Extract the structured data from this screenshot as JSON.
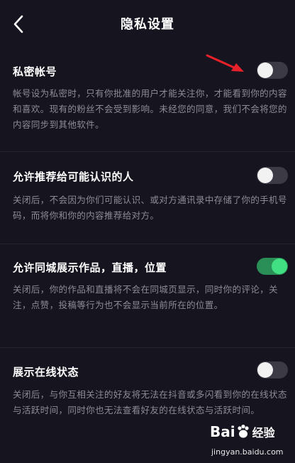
{
  "header": {
    "title": "隐私设置",
    "back_icon": "chevron-left-icon"
  },
  "settings": [
    {
      "title": "私密帐号",
      "description": "帐号设为私密时，只有你批准的用户才能关注你，才能看到你的内容和喜欢。现有的粉丝不会受到影响。未经您的同意，我们不会将您的内容同步到其他软件。",
      "enabled": false
    },
    {
      "title": "允许推荐给可能认识的人",
      "description": "关闭后，不会因为你们可能认识、或对方通讯录中存储了你的手机号码，而将你和你的内容推荐给对方。",
      "enabled": false
    },
    {
      "title": "允许同城展示作品，直播，位置",
      "description": "关闭后，你的作品和直播将不会在同城页显示，同时你的评论，关注，点赞，投稿等行为也不会显示当前所在的位置。",
      "enabled": true
    },
    {
      "title": "展示在线状态",
      "description": "关闭后，与你互相关注的好友将无法在抖音或多闪看到你的在线状态与活跃时间，同时你也无法查看好友的在线状态与活跃时间。",
      "enabled": false
    }
  ],
  "watermark": {
    "brand": "Bai",
    "brand_suffix": "经验",
    "url": "jingyan.baidu.com"
  },
  "colors": {
    "background": "#15141f",
    "toggle_off": "#3b3a45",
    "toggle_on": "#2a8f56",
    "toggle_on_knob": "#41e082",
    "annotation_arrow": "#e8202a",
    "description_text": "#8c8b96"
  }
}
